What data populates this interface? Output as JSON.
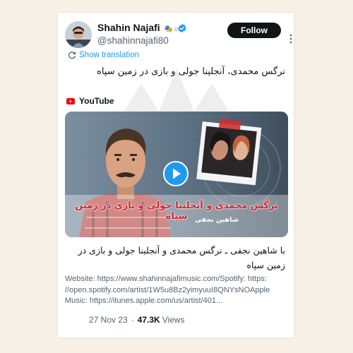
{
  "tweet": {
    "author": {
      "display_name": "Shahin Najafi",
      "name_emoji": "🎭☼",
      "handle": "@shahinnajafi80"
    },
    "follow_label": "Follow",
    "show_translation_label": "Show translation",
    "text": "نرگس محمدی، آنجلینا جولی و بازی در زمین سپاه",
    "card": {
      "source": "YouTube",
      "thumbnail_title": "نرگس محمدی و آنجلینا جولی و بازی در زمین سپاه",
      "thumbnail_artist": "شاهین نجفی",
      "video_title": "با شاهین نجفی ـ نرگس محمدی و آنجلینا جولی و بازی در زمین سپاه",
      "description_lines": [
        "Website: https://www.shahinnajafimusic.com/Spotify: https:",
        "//open.spotify.com/artist/1W5u8Bz2yimyuuI8QNYsNOApple",
        "Music: https://itunes.apple.com/us/artist/401..."
      ]
    },
    "date": "27 Nov 23",
    "views_count": "47.3K",
    "views_label": "Views"
  },
  "colors": {
    "page_background": "#f7f0e6",
    "accent_blue": "#1d9bf0",
    "follow_button_bg": "#0f1419",
    "youtube_red": "#ff0000",
    "thumbnail_title_red": "#d81f2a"
  },
  "icons": {
    "verified": "verified-badge-icon",
    "translate": "translate-icon",
    "youtube": "youtube-icon",
    "play": "play-icon",
    "more": "more-options-icon"
  }
}
